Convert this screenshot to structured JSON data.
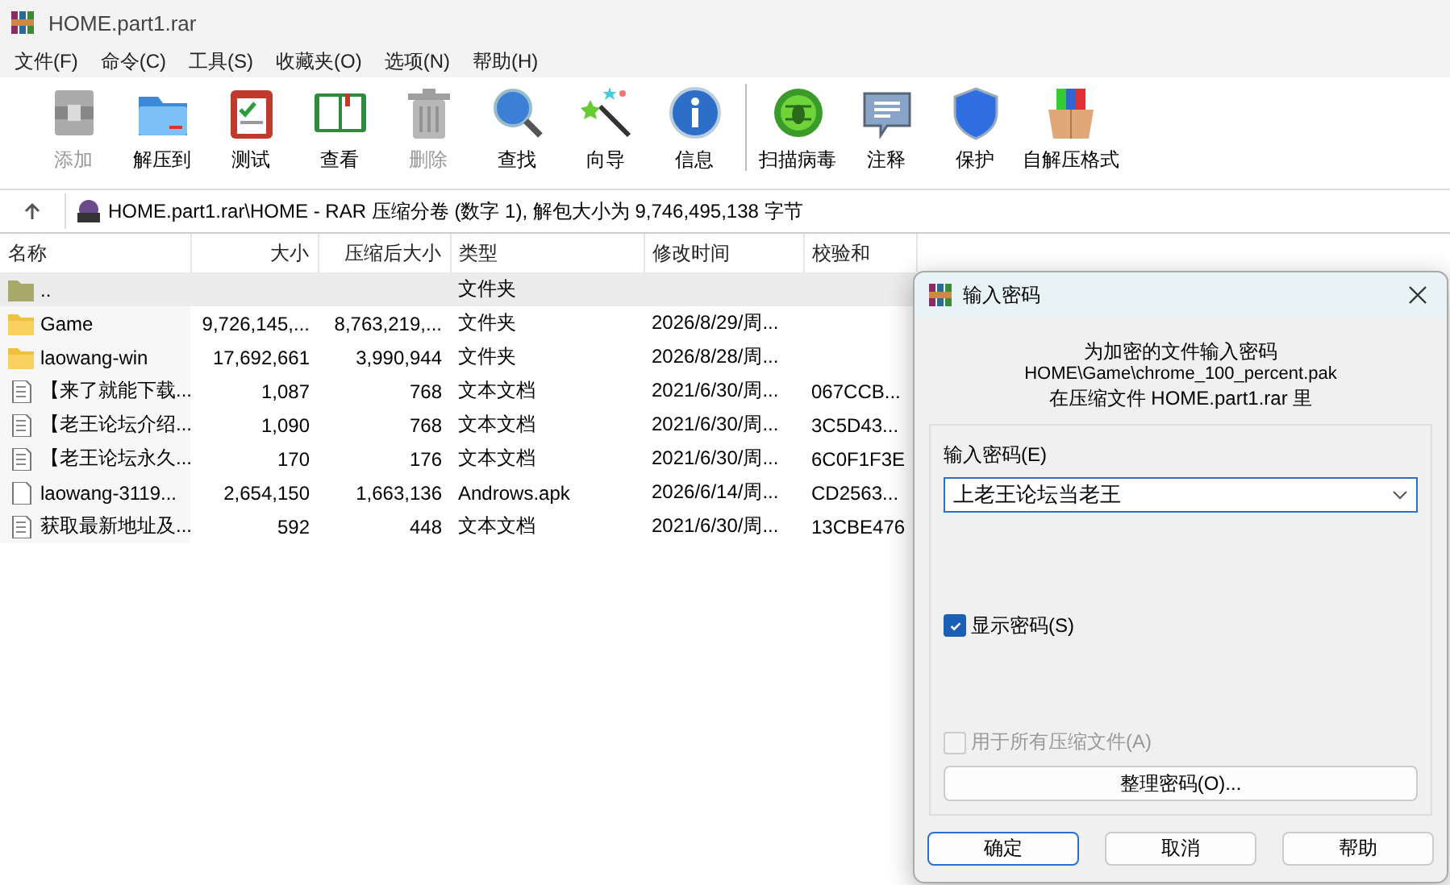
{
  "window": {
    "title": "HOME.part1.rar"
  },
  "menu": [
    "文件(F)",
    "命令(C)",
    "工具(S)",
    "收藏夹(O)",
    "选项(N)",
    "帮助(H)"
  ],
  "toolbar": [
    {
      "kind": "add",
      "label": "添加",
      "disabled": true
    },
    {
      "kind": "extract",
      "label": "解压到",
      "disabled": false
    },
    {
      "kind": "test",
      "label": "测试",
      "disabled": false
    },
    {
      "kind": "view",
      "label": "查看",
      "disabled": false
    },
    {
      "kind": "delete",
      "label": "删除",
      "disabled": true
    },
    {
      "kind": "find",
      "label": "查找",
      "disabled": false
    },
    {
      "kind": "wizard",
      "label": "向导",
      "disabled": false
    },
    {
      "kind": "info",
      "label": "信息",
      "disabled": false
    },
    {
      "kind": "scan",
      "label": "扫描病毒",
      "disabled": false
    },
    {
      "kind": "comment",
      "label": "注释",
      "disabled": false
    },
    {
      "kind": "protect",
      "label": "保护",
      "disabled": false
    },
    {
      "kind": "sfx",
      "label": "自解压格式",
      "disabled": false
    }
  ],
  "address": {
    "path": "HOME.part1.rar\\HOME - RAR 压缩分卷 (数字 1), 解包大小为 9,746,495,138 字节"
  },
  "table": {
    "columns": [
      "名称",
      "大小",
      "压缩后大小",
      "类型",
      "修改时间",
      "校验和"
    ],
    "rows": [
      {
        "kind": "parent",
        "selected": true,
        "cells": [
          "..",
          "",
          "",
          "文件夹",
          "",
          ""
        ]
      },
      {
        "kind": "folder",
        "selected": false,
        "cells": [
          "Game",
          "9,726,145,...",
          "8,763,219,...",
          "文件夹",
          "2026/8/29/周...",
          ""
        ]
      },
      {
        "kind": "folder",
        "selected": false,
        "cells": [
          "laowang-win",
          "17,692,661",
          "3,990,944",
          "文件夹",
          "2026/8/28/周...",
          ""
        ]
      },
      {
        "kind": "text",
        "selected": false,
        "cells": [
          "【来了就能下载...",
          "1,087",
          "768",
          "文本文档",
          "2021/6/30/周...",
          "067CCB..."
        ]
      },
      {
        "kind": "text",
        "selected": false,
        "cells": [
          "【老王论坛介绍...",
          "1,090",
          "768",
          "文本文档",
          "2021/6/30/周...",
          "3C5D43..."
        ]
      },
      {
        "kind": "text",
        "selected": false,
        "cells": [
          "【老王论坛永久...",
          "170",
          "176",
          "文本文档",
          "2021/6/30/周...",
          "6C0F1F3E"
        ]
      },
      {
        "kind": "file",
        "selected": false,
        "cells": [
          "laowang-3119...",
          "2,654,150",
          "1,663,136",
          "Androws.apk",
          "2026/6/14/周...",
          "CD2563..."
        ]
      },
      {
        "kind": "text",
        "selected": false,
        "cells": [
          "获取最新地址及...",
          "592",
          "448",
          "文本文档",
          "2021/6/30/周...",
          "13CBE476"
        ]
      }
    ]
  },
  "dialog": {
    "title": "输入密码",
    "heading": "为加密的文件输入密码",
    "file": "HOME\\Game\\chrome_100_percent.pak",
    "archive": "在压缩文件 HOME.part1.rar 里",
    "password_label": "输入密码(E)",
    "password_value": "上老王论坛当老王",
    "show_password": {
      "label": "显示密码(S)",
      "checked": true
    },
    "use_for_all": {
      "label": "用于所有压缩文件(A)",
      "checked": false,
      "disabled": true
    },
    "organize_button": "整理密码(O)...",
    "buttons": [
      {
        "label": "确定",
        "selected": true
      },
      {
        "label": "取消",
        "selected": false
      },
      {
        "label": "帮助",
        "selected": false
      }
    ]
  }
}
